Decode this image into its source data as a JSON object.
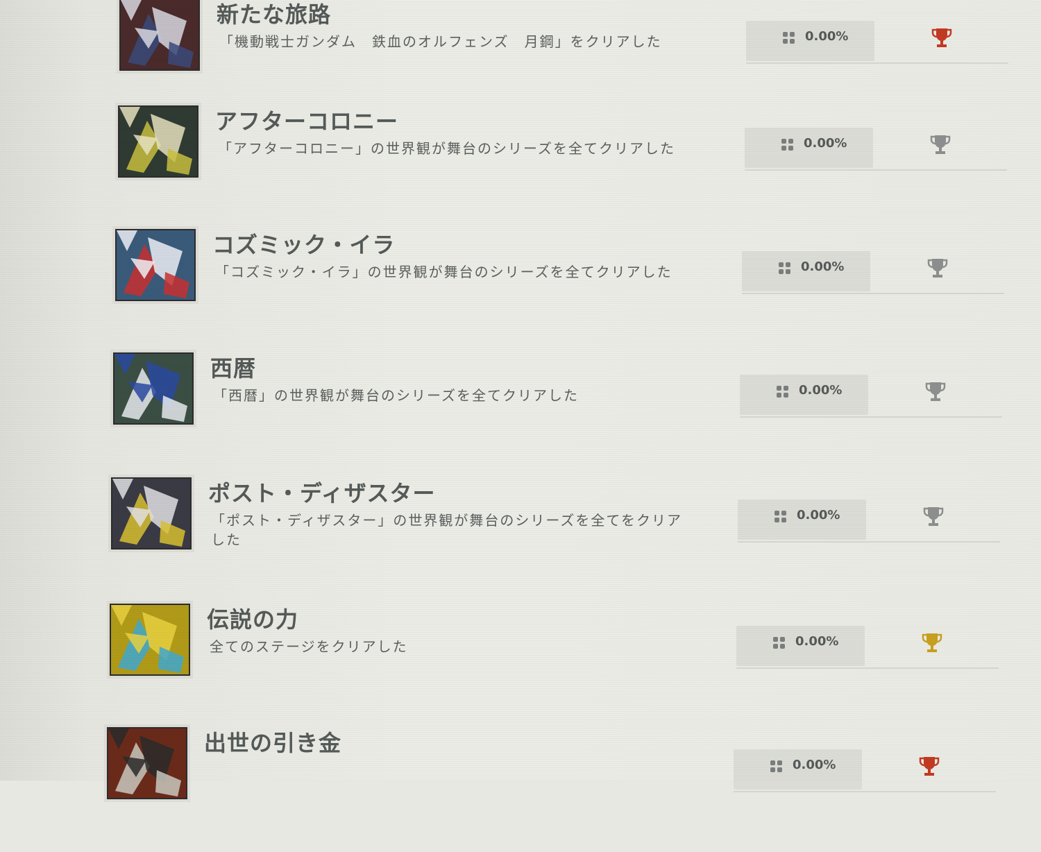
{
  "achievements": [
    {
      "title": "新たな旅路",
      "description": "「機動戦士ガンダム　鉄血のオルフェンズ　月鋼」をクリアした",
      "rarity": "0.00%",
      "trophy": "bronze-trophy",
      "trophy_color": "#c23a22",
      "thumb": {
        "bg": "#4a2a2a",
        "accent": "#d8d8e0",
        "accent2": "#3a4a7a"
      }
    },
    {
      "title": "アフターコロニー",
      "description": "「アフターコロニー」の世界観が舞台のシリーズを全てクリアした",
      "rarity": "0.00%",
      "trophy": "silver-trophy",
      "trophy_color": "#8c8f8e",
      "thumb": {
        "bg": "#2f3a32",
        "accent": "#e6e2c0",
        "accent2": "#c8c040"
      }
    },
    {
      "title": "コズミック・イラ",
      "description": "「コズミック・イラ」の世界観が舞台のシリーズを全てクリアした",
      "rarity": "0.00%",
      "trophy": "silver-trophy",
      "trophy_color": "#8c8f8e",
      "thumb": {
        "bg": "#3a5a7a",
        "accent": "#eef0f4",
        "accent2": "#c83030"
      }
    },
    {
      "title": "西暦",
      "description": "「西暦」の世界観が舞台のシリーズを全てクリアした",
      "rarity": "0.00%",
      "trophy": "silver-trophy",
      "trophy_color": "#8c8f8e",
      "thumb": {
        "bg": "#3a4e44",
        "accent": "#2a4aa0",
        "accent2": "#e8eaee"
      }
    },
    {
      "title": "ポスト・ディザスター",
      "description": "「ポスト・ディザスター」の世界観が舞台のシリーズを全てをクリアした",
      "rarity": "0.00%",
      "trophy": "silver-trophy",
      "trophy_color": "#8c8f8e",
      "thumb": {
        "bg": "#3a3a44",
        "accent": "#e0e0e4",
        "accent2": "#d8c030"
      }
    },
    {
      "title": "伝説の力",
      "description": "全てのステージをクリアした",
      "rarity": "0.00%",
      "trophy": "gold-trophy",
      "trophy_color": "#c8a020",
      "thumb": {
        "bg": "#b09a18",
        "accent": "#e8d040",
        "accent2": "#40a8d0"
      }
    },
    {
      "title": "出世の引き金",
      "description": "",
      "rarity": "0.00%",
      "trophy": "bronze-trophy",
      "trophy_color": "#c23a22",
      "thumb": {
        "bg": "#6a2a1a",
        "accent": "#2a2a2a",
        "accent2": "#c8c8c0"
      }
    }
  ]
}
